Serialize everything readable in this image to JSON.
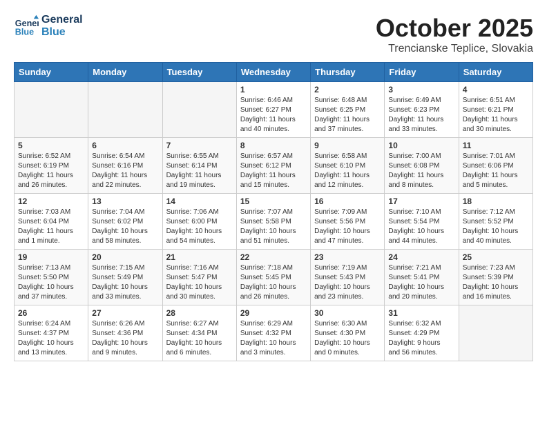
{
  "header": {
    "logo_line1": "General",
    "logo_line2": "Blue",
    "month": "October 2025",
    "location": "Trencianske Teplice, Slovakia"
  },
  "weekdays": [
    "Sunday",
    "Monday",
    "Tuesday",
    "Wednesday",
    "Thursday",
    "Friday",
    "Saturday"
  ],
  "weeks": [
    [
      {
        "day": "",
        "info": ""
      },
      {
        "day": "",
        "info": ""
      },
      {
        "day": "",
        "info": ""
      },
      {
        "day": "1",
        "info": "Sunrise: 6:46 AM\nSunset: 6:27 PM\nDaylight: 11 hours\nand 40 minutes."
      },
      {
        "day": "2",
        "info": "Sunrise: 6:48 AM\nSunset: 6:25 PM\nDaylight: 11 hours\nand 37 minutes."
      },
      {
        "day": "3",
        "info": "Sunrise: 6:49 AM\nSunset: 6:23 PM\nDaylight: 11 hours\nand 33 minutes."
      },
      {
        "day": "4",
        "info": "Sunrise: 6:51 AM\nSunset: 6:21 PM\nDaylight: 11 hours\nand 30 minutes."
      }
    ],
    [
      {
        "day": "5",
        "info": "Sunrise: 6:52 AM\nSunset: 6:19 PM\nDaylight: 11 hours\nand 26 minutes."
      },
      {
        "day": "6",
        "info": "Sunrise: 6:54 AM\nSunset: 6:16 PM\nDaylight: 11 hours\nand 22 minutes."
      },
      {
        "day": "7",
        "info": "Sunrise: 6:55 AM\nSunset: 6:14 PM\nDaylight: 11 hours\nand 19 minutes."
      },
      {
        "day": "8",
        "info": "Sunrise: 6:57 AM\nSunset: 6:12 PM\nDaylight: 11 hours\nand 15 minutes."
      },
      {
        "day": "9",
        "info": "Sunrise: 6:58 AM\nSunset: 6:10 PM\nDaylight: 11 hours\nand 12 minutes."
      },
      {
        "day": "10",
        "info": "Sunrise: 7:00 AM\nSunset: 6:08 PM\nDaylight: 11 hours\nand 8 minutes."
      },
      {
        "day": "11",
        "info": "Sunrise: 7:01 AM\nSunset: 6:06 PM\nDaylight: 11 hours\nand 5 minutes."
      }
    ],
    [
      {
        "day": "12",
        "info": "Sunrise: 7:03 AM\nSunset: 6:04 PM\nDaylight: 11 hours\nand 1 minute."
      },
      {
        "day": "13",
        "info": "Sunrise: 7:04 AM\nSunset: 6:02 PM\nDaylight: 10 hours\nand 58 minutes."
      },
      {
        "day": "14",
        "info": "Sunrise: 7:06 AM\nSunset: 6:00 PM\nDaylight: 10 hours\nand 54 minutes."
      },
      {
        "day": "15",
        "info": "Sunrise: 7:07 AM\nSunset: 5:58 PM\nDaylight: 10 hours\nand 51 minutes."
      },
      {
        "day": "16",
        "info": "Sunrise: 7:09 AM\nSunset: 5:56 PM\nDaylight: 10 hours\nand 47 minutes."
      },
      {
        "day": "17",
        "info": "Sunrise: 7:10 AM\nSunset: 5:54 PM\nDaylight: 10 hours\nand 44 minutes."
      },
      {
        "day": "18",
        "info": "Sunrise: 7:12 AM\nSunset: 5:52 PM\nDaylight: 10 hours\nand 40 minutes."
      }
    ],
    [
      {
        "day": "19",
        "info": "Sunrise: 7:13 AM\nSunset: 5:50 PM\nDaylight: 10 hours\nand 37 minutes."
      },
      {
        "day": "20",
        "info": "Sunrise: 7:15 AM\nSunset: 5:49 PM\nDaylight: 10 hours\nand 33 minutes."
      },
      {
        "day": "21",
        "info": "Sunrise: 7:16 AM\nSunset: 5:47 PM\nDaylight: 10 hours\nand 30 minutes."
      },
      {
        "day": "22",
        "info": "Sunrise: 7:18 AM\nSunset: 5:45 PM\nDaylight: 10 hours\nand 26 minutes."
      },
      {
        "day": "23",
        "info": "Sunrise: 7:19 AM\nSunset: 5:43 PM\nDaylight: 10 hours\nand 23 minutes."
      },
      {
        "day": "24",
        "info": "Sunrise: 7:21 AM\nSunset: 5:41 PM\nDaylight: 10 hours\nand 20 minutes."
      },
      {
        "day": "25",
        "info": "Sunrise: 7:23 AM\nSunset: 5:39 PM\nDaylight: 10 hours\nand 16 minutes."
      }
    ],
    [
      {
        "day": "26",
        "info": "Sunrise: 6:24 AM\nSunset: 4:37 PM\nDaylight: 10 hours\nand 13 minutes."
      },
      {
        "day": "27",
        "info": "Sunrise: 6:26 AM\nSunset: 4:36 PM\nDaylight: 10 hours\nand 9 minutes."
      },
      {
        "day": "28",
        "info": "Sunrise: 6:27 AM\nSunset: 4:34 PM\nDaylight: 10 hours\nand 6 minutes."
      },
      {
        "day": "29",
        "info": "Sunrise: 6:29 AM\nSunset: 4:32 PM\nDaylight: 10 hours\nand 3 minutes."
      },
      {
        "day": "30",
        "info": "Sunrise: 6:30 AM\nSunset: 4:30 PM\nDaylight: 10 hours\nand 0 minutes."
      },
      {
        "day": "31",
        "info": "Sunrise: 6:32 AM\nSunset: 4:29 PM\nDaylight: 9 hours\nand 56 minutes."
      },
      {
        "day": "",
        "info": ""
      }
    ]
  ]
}
